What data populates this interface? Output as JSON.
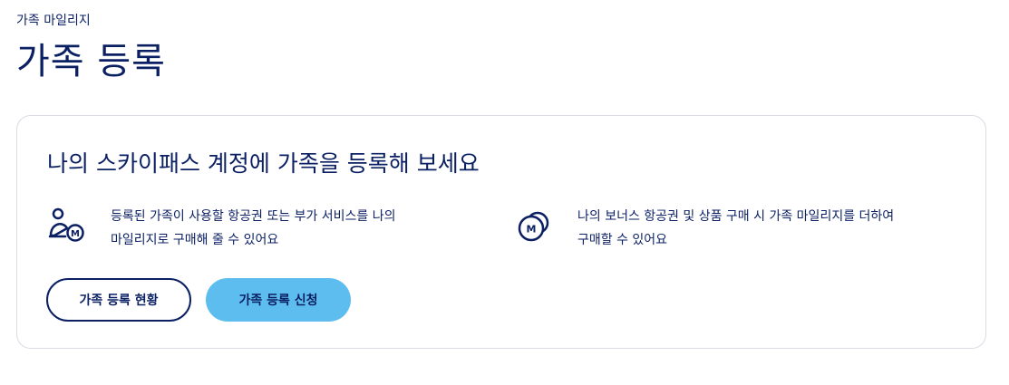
{
  "breadcrumb": "가족 마일리지",
  "page_title": "가족 등록",
  "card": {
    "title": "나의 스카이패스 계정에 가족을 등록해 보세요",
    "features": [
      {
        "icon": "family-mileage-icon",
        "text_line1": "등록된 가족이 사용할 항공권 또는 부가 서비스를 나의",
        "text_line2": "마일리지로 구매해 줄 수 있어요"
      },
      {
        "icon": "bonus-mileage-coins-icon",
        "text_line1": "나의 보너스 항공권 및 상품 구매 시 가족 마일리지를 더하여",
        "text_line2": "구매할 수 있어요"
      }
    ],
    "buttons": {
      "status_label": "가족 등록 현황",
      "apply_label": "가족 등록 신청"
    }
  },
  "colors": {
    "navy": "#0b1f63",
    "accent_blue": "#5dbdee",
    "card_border": "#d9dce3"
  }
}
